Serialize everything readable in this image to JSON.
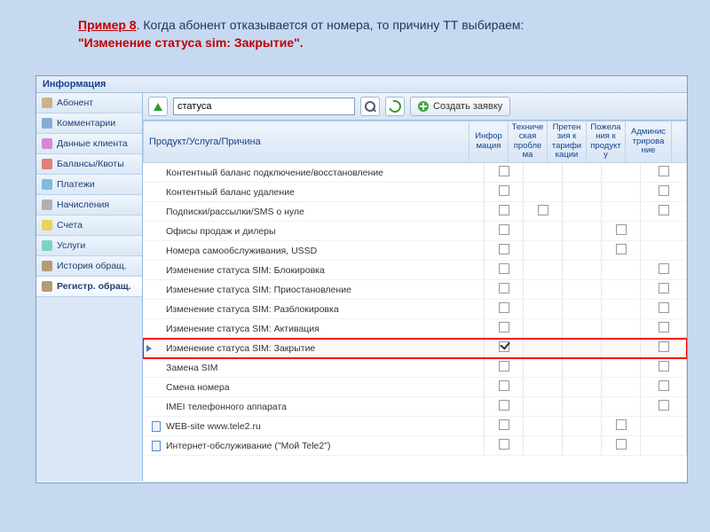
{
  "instruction": {
    "example": "Пример 8",
    "text1": ". Когда абонент отказывается от номера, то причину ТТ выбираем:",
    "quoted": "\"Изменение статуса sim: Закрытие\"."
  },
  "app_title": "Информация",
  "sidebar": {
    "items": [
      {
        "label": "Абонент",
        "color": "#c9b489"
      },
      {
        "label": "Комментарии",
        "color": "#8aa9d6"
      },
      {
        "label": "Данные клиента",
        "color": "#d48ad3"
      },
      {
        "label": "Балансы/Квоты",
        "color": "#e37e7e"
      },
      {
        "label": "Платежи",
        "color": "#7bbde0"
      },
      {
        "label": "Начисления",
        "color": "#b0b0b0"
      },
      {
        "label": "Счета",
        "color": "#e8d35a"
      },
      {
        "label": "Услуги",
        "color": "#7bd4c1"
      },
      {
        "label": "История обращ.",
        "color": "#b59b7a"
      },
      {
        "label": "Регистр. обращ.",
        "color": "#b59b7a",
        "active": true
      }
    ]
  },
  "toolbar": {
    "search_value": "статуса",
    "create_label": "Создать заявку"
  },
  "columns": {
    "product": "Продукт/Услуга/Причина",
    "c1": "Инфор мация",
    "c2": "Техниче ская пробле ма",
    "c3": "Претен зия к тарифи кации",
    "c4": "Пожела ния к продукт у",
    "c5": "Админис трирова ние"
  },
  "rows": [
    {
      "label": "Контентный баланс подключение/восстановление",
      "c": [
        1,
        0,
        0,
        0,
        1
      ]
    },
    {
      "label": "Контентный баланс удаление",
      "c": [
        1,
        0,
        0,
        0,
        1
      ]
    },
    {
      "label": "Подписки/рассылки/SMS о нуле",
      "c": [
        1,
        1,
        0,
        0,
        1
      ]
    },
    {
      "label": "Офисы продаж и дилеры",
      "c": [
        1,
        0,
        0,
        1,
        0
      ]
    },
    {
      "label": "Номера самообслуживания, USSD",
      "c": [
        1,
        0,
        0,
        1,
        0
      ]
    },
    {
      "label": "Изменение статуса SIM: Блокировка",
      "c": [
        1,
        0,
        0,
        0,
        1
      ]
    },
    {
      "label": "Изменение статуса SIM: Приостановление",
      "c": [
        1,
        0,
        0,
        0,
        1
      ]
    },
    {
      "label": "Изменение статуса SIM: Разблокировка",
      "c": [
        1,
        0,
        0,
        0,
        1
      ]
    },
    {
      "label": "Изменение статуса SIM: Активация",
      "c": [
        1,
        0,
        0,
        0,
        1
      ]
    },
    {
      "label": "Изменение статуса SIM: Закрытие",
      "c": [
        2,
        0,
        0,
        0,
        1
      ],
      "hl": true,
      "tri": true
    },
    {
      "label": "Замена SIM",
      "c": [
        1,
        0,
        0,
        0,
        1
      ]
    },
    {
      "label": "Смена номера",
      "c": [
        1,
        0,
        0,
        0,
        1
      ]
    },
    {
      "label": "IMEI телефонного аппарата",
      "c": [
        1,
        0,
        0,
        0,
        1
      ]
    },
    {
      "label": "WEB-site www.tele2.ru",
      "c": [
        1,
        0,
        0,
        1,
        0
      ],
      "doc": true
    },
    {
      "label": "Интернет-обслуживание (\"Мой Tele2\")",
      "c": [
        1,
        0,
        0,
        1,
        0
      ],
      "doc": true
    }
  ]
}
